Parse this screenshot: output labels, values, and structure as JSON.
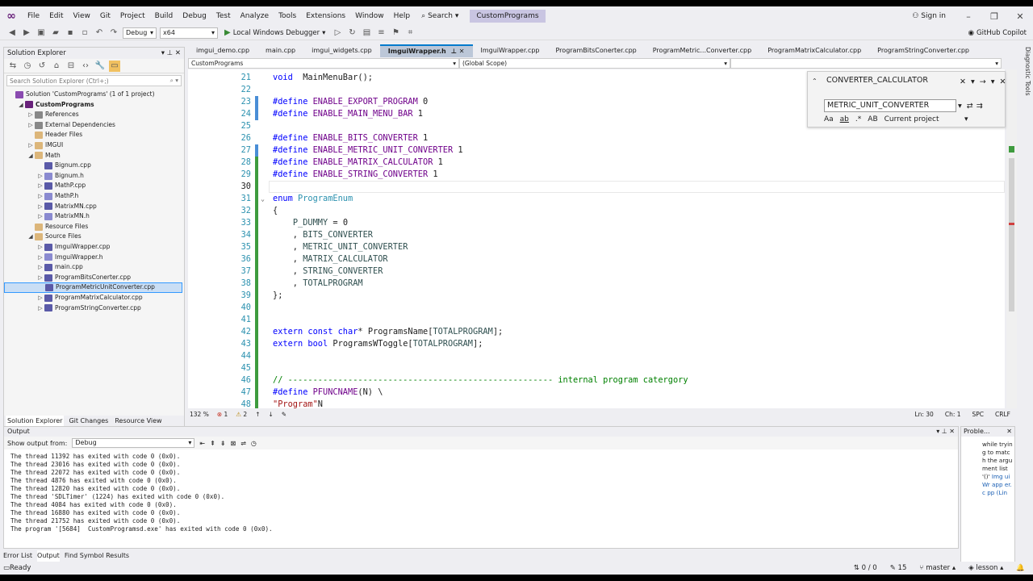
{
  "menu": {
    "items": [
      "File",
      "Edit",
      "View",
      "Git",
      "Project",
      "Build",
      "Debug",
      "Test",
      "Analyze",
      "Tools",
      "Extensions",
      "Window",
      "Help"
    ],
    "search": "Search",
    "solution": "CustomPrograms",
    "signin": "Sign in"
  },
  "toolbar": {
    "config": "Debug",
    "platform": "x64",
    "run": "Local Windows Debugger",
    "copilot": "GitHub Copilot"
  },
  "solution_explorer": {
    "title": "Solution Explorer",
    "search_placeholder": "Search Solution Explorer (Ctrl+;)",
    "items": [
      {
        "label": "Solution 'CustomPrograms' (1 of 1 project)",
        "icon": "sol",
        "indent": 0,
        "tw": ""
      },
      {
        "label": "CustomPrograms",
        "icon": "proj",
        "indent": 1,
        "tw": "◢",
        "bold": true
      },
      {
        "label": "References",
        "icon": "ref",
        "indent": 2,
        "tw": "▷"
      },
      {
        "label": "External Dependencies",
        "icon": "ref",
        "indent": 2,
        "tw": "▷"
      },
      {
        "label": "Header Files",
        "icon": "folder",
        "indent": 2,
        "tw": ""
      },
      {
        "label": "IMGUI",
        "icon": "folder",
        "indent": 2,
        "tw": "▷"
      },
      {
        "label": "Math",
        "icon": "folder",
        "indent": 2,
        "tw": "◢"
      },
      {
        "label": "Bignum.cpp",
        "icon": "cpp",
        "indent": 3,
        "tw": ""
      },
      {
        "label": "Bignum.h",
        "icon": "h",
        "indent": 3,
        "tw": "▷"
      },
      {
        "label": "MathP.cpp",
        "icon": "cpp",
        "indent": 3,
        "tw": "▷"
      },
      {
        "label": "MathP.h",
        "icon": "h",
        "indent": 3,
        "tw": "▷"
      },
      {
        "label": "MatrixMN.cpp",
        "icon": "cpp",
        "indent": 3,
        "tw": "▷"
      },
      {
        "label": "MatrixMN.h",
        "icon": "h",
        "indent": 3,
        "tw": "▷"
      },
      {
        "label": "Resource Files",
        "icon": "folder",
        "indent": 2,
        "tw": ""
      },
      {
        "label": "Source Files",
        "icon": "folder",
        "indent": 2,
        "tw": "◢"
      },
      {
        "label": "ImguiWrapper.cpp",
        "icon": "cpp",
        "indent": 3,
        "tw": "▷"
      },
      {
        "label": "ImguiWrapper.h",
        "icon": "h",
        "indent": 3,
        "tw": "▷"
      },
      {
        "label": "main.cpp",
        "icon": "cpp",
        "indent": 3,
        "tw": "▷"
      },
      {
        "label": "ProgramBitsConerter.cpp",
        "icon": "cpp",
        "indent": 3,
        "tw": "▷"
      },
      {
        "label": "ProgramMetricUnitConverter.cpp",
        "icon": "cpp",
        "indent": 3,
        "tw": "",
        "selected": true
      },
      {
        "label": "ProgramMatrixCalculator.cpp",
        "icon": "cpp",
        "indent": 3,
        "tw": "▷"
      },
      {
        "label": "ProgramStringConverter.cpp",
        "icon": "cpp",
        "indent": 3,
        "tw": "▷"
      }
    ],
    "tabs": [
      "Solution Explorer",
      "Git Changes",
      "Resource View"
    ]
  },
  "tabs": [
    {
      "label": "imgui_demo.cpp"
    },
    {
      "label": "main.cpp"
    },
    {
      "label": "imgui_widgets.cpp"
    },
    {
      "label": "ImguiWrapper.h",
      "active": true
    },
    {
      "label": "ImguiWrapper.cpp"
    },
    {
      "label": "ProgramBitsConerter.cpp"
    },
    {
      "label": "ProgramMetric...Converter.cpp"
    },
    {
      "label": "ProgramMatrixCalculator.cpp"
    },
    {
      "label": "ProgramStringConverter.cpp"
    }
  ],
  "navbar": {
    "project": "CustomPrograms",
    "scope": "(Global Scope)"
  },
  "code": [
    {
      "n": "21",
      "segs": [
        [
          "kw",
          "void"
        ],
        [
          "",
          "  MainMenuBar();"
        ]
      ]
    },
    {
      "n": "22",
      "segs": []
    },
    {
      "n": "23",
      "segs": [
        [
          "kw",
          "#define"
        ],
        [
          "",
          " "
        ],
        [
          "mac",
          "ENABLE_EXPORT_PROGRAM"
        ],
        [
          "",
          " 0"
        ]
      ]
    },
    {
      "n": "24",
      "segs": [
        [
          "kw",
          "#define"
        ],
        [
          "",
          " "
        ],
        [
          "mac",
          "ENABLE_MAIN_MENU_BAR"
        ],
        [
          "",
          " 1"
        ]
      ]
    },
    {
      "n": "25",
      "segs": []
    },
    {
      "n": "26",
      "segs": [
        [
          "kw",
          "#define"
        ],
        [
          "",
          " "
        ],
        [
          "mac",
          "ENABLE_BITS_CONVERTER"
        ],
        [
          "",
          " 1"
        ]
      ]
    },
    {
      "n": "27",
      "segs": [
        [
          "kw",
          "#define"
        ],
        [
          "",
          " "
        ],
        [
          "mac",
          "ENABLE_METRIC_UNIT_CONVERTER"
        ],
        [
          "",
          " 1"
        ]
      ]
    },
    {
      "n": "28",
      "segs": [
        [
          "kw",
          "#define"
        ],
        [
          "",
          " "
        ],
        [
          "mac",
          "ENABLE_MATRIX_CALCULATOR"
        ],
        [
          "",
          " 1"
        ]
      ]
    },
    {
      "n": "29",
      "segs": [
        [
          "kw",
          "#define"
        ],
        [
          "",
          " "
        ],
        [
          "mac",
          "ENABLE_STRING_CONVERTER"
        ],
        [
          "",
          " 1"
        ]
      ]
    },
    {
      "n": "30",
      "segs": [],
      "current": true
    },
    {
      "n": "31",
      "segs": [
        [
          "kw",
          "enum"
        ],
        [
          "",
          " "
        ],
        [
          "ty",
          "ProgramEnum"
        ]
      ],
      "fold": true
    },
    {
      "n": "32",
      "segs": [
        [
          "",
          "{"
        ]
      ]
    },
    {
      "n": "33",
      "segs": [
        [
          "",
          "    "
        ],
        [
          "enm",
          "P_DUMMY"
        ],
        [
          "",
          " = 0"
        ]
      ]
    },
    {
      "n": "34",
      "segs": [
        [
          "",
          "    , "
        ],
        [
          "enm",
          "BITS_CONVERTER"
        ]
      ]
    },
    {
      "n": "35",
      "segs": [
        [
          "",
          "    , "
        ],
        [
          "enm",
          "METRIC_UNIT_CONVERTER"
        ]
      ]
    },
    {
      "n": "36",
      "segs": [
        [
          "",
          "    , "
        ],
        [
          "enm",
          "MATRIX_CALCULATOR"
        ]
      ]
    },
    {
      "n": "37",
      "segs": [
        [
          "",
          "    , "
        ],
        [
          "enm",
          "STRING_CONVERTER"
        ]
      ]
    },
    {
      "n": "38",
      "segs": [
        [
          "",
          "    , "
        ],
        [
          "enm",
          "TOTALPROGRAM"
        ]
      ]
    },
    {
      "n": "39",
      "segs": [
        [
          "",
          "};"
        ]
      ]
    },
    {
      "n": "40",
      "segs": []
    },
    {
      "n": "41",
      "segs": []
    },
    {
      "n": "42",
      "segs": [
        [
          "kw",
          "extern"
        ],
        [
          "",
          " "
        ],
        [
          "kw",
          "const"
        ],
        [
          "",
          " "
        ],
        [
          "kw",
          "char"
        ],
        [
          "",
          "* ProgramsName["
        ],
        [
          "enm",
          "TOTALPROGRAM"
        ],
        [
          "",
          "];"
        ]
      ]
    },
    {
      "n": "43",
      "segs": [
        [
          "kw",
          "extern"
        ],
        [
          "",
          " "
        ],
        [
          "kw",
          "bool"
        ],
        [
          "",
          " ProgramsWToggle["
        ],
        [
          "enm",
          "TOTALPROGRAM"
        ],
        [
          "",
          "];"
        ]
      ]
    },
    {
      "n": "44",
      "segs": []
    },
    {
      "n": "45",
      "segs": []
    },
    {
      "n": "46",
      "segs": [
        [
          "cmt",
          "// ----------------------------------------------------- internal program catergory"
        ]
      ]
    },
    {
      "n": "47",
      "segs": [
        [
          "kw",
          "#define"
        ],
        [
          "",
          " "
        ],
        [
          "mac",
          "PFUNCNAME"
        ],
        [
          "",
          "(N) \\"
        ]
      ]
    },
    {
      "n": "48",
      "segs": [
        [
          "str",
          "\"Program\""
        ],
        [
          "",
          "N"
        ]
      ]
    }
  ],
  "find": {
    "find": "CONVERTER_CALCULATOR",
    "replace": "METRIC_UNIT_CONVERTER",
    "scope": "Current project",
    "opt_case": "Aa",
    "opt_word": "ab",
    "opt_regex": ".*",
    "opt_preserve": "AB"
  },
  "editor_status": {
    "zoom": "132 %",
    "errors": "1",
    "warnings": "2",
    "ln": "Ln: 30",
    "ch": "Ch: 1",
    "spc": "SPC",
    "crlf": "CRLF"
  },
  "output": {
    "title": "Output",
    "show_from": "Show output from:",
    "source": "Debug",
    "lines": [
      "The thread 11392 has exited with code 0 (0x0).",
      "The thread 23016 has exited with code 0 (0x0).",
      "The thread 22072 has exited with code 0 (0x0).",
      "The thread 4876 has exited with code 0 (0x0).",
      "The thread 12820 has exited with code 0 (0x0).",
      "The thread 'SDLTimer' (1224) has exited with code 0 (0x0).",
      "The thread 4084 has exited with code 0 (0x0).",
      "The thread 16880 has exited with code 0 (0x0).",
      "The thread 21752 has exited with code 0 (0x0).",
      "The program '[5684]  CustomProgramsd.exe' has exited with code 0 (0x0)."
    ],
    "tabs": [
      "Error List",
      "Output",
      "Find Symbol Results"
    ]
  },
  "problems": {
    "title": "Proble...",
    "text": "while tryin g to matc h the argu ment list '()'",
    "link": "Img uiWr app er.c pp (Lin"
  },
  "statusbar": {
    "ready": "Ready",
    "sync": "0 / 0",
    "pencil": "15",
    "branch": "master",
    "repo": "lesson"
  },
  "diag_tools": "Diagnostic Tools"
}
